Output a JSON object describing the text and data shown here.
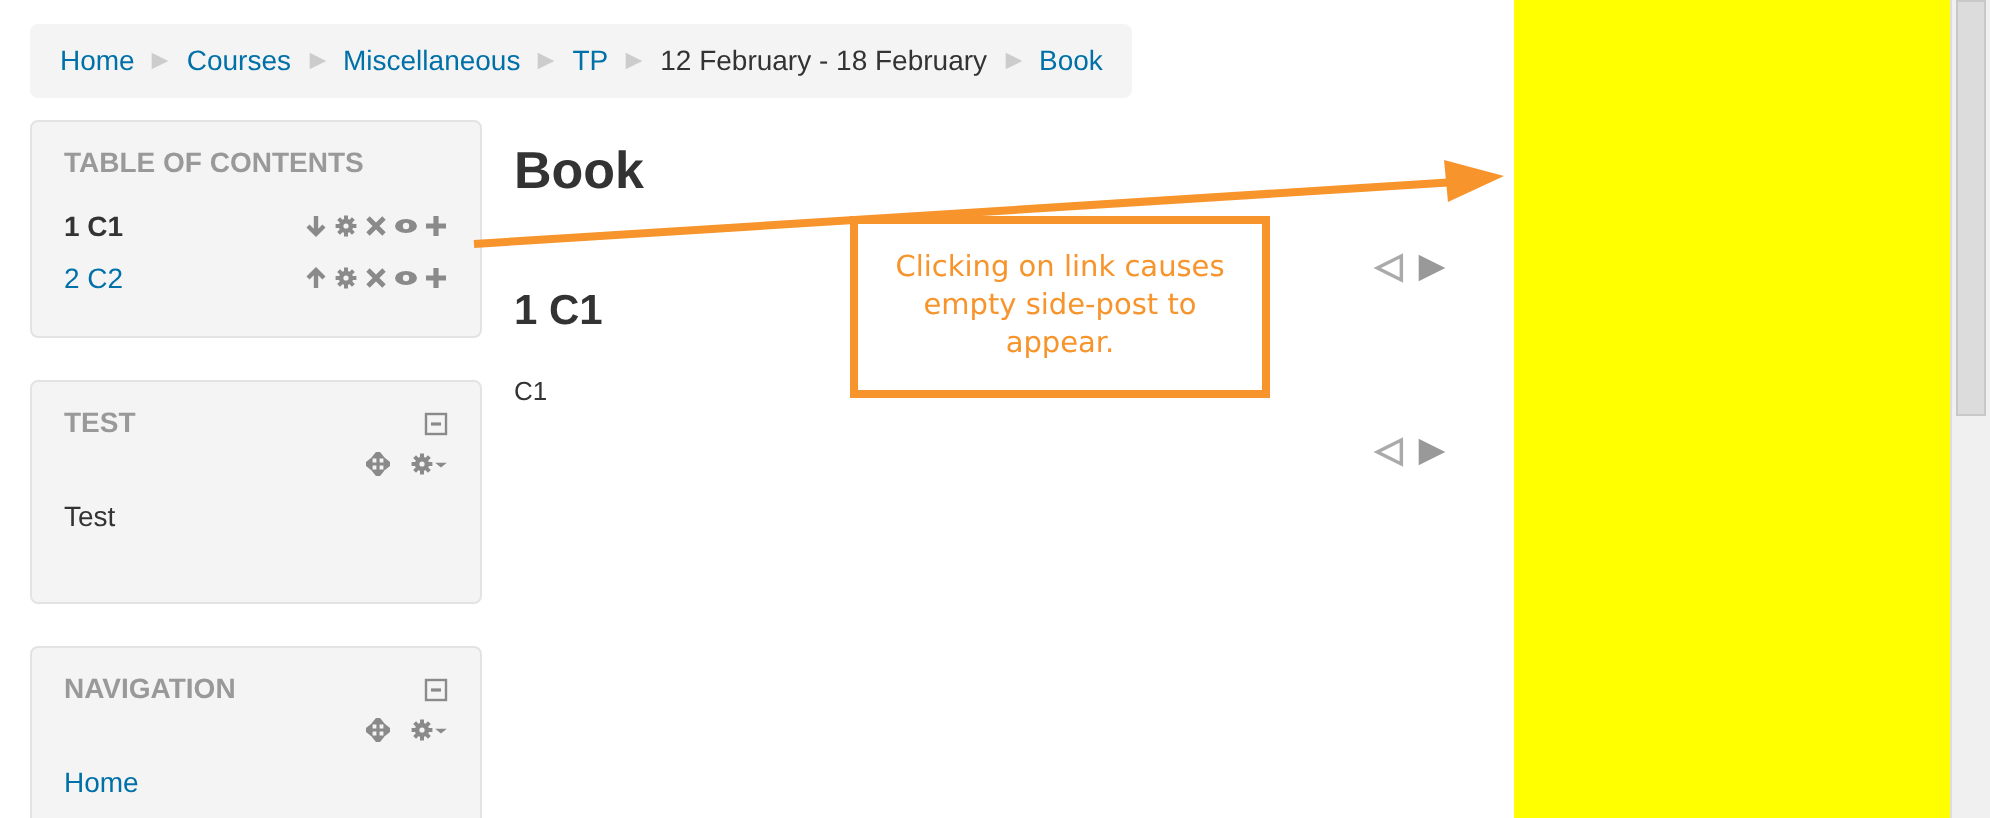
{
  "breadcrumb": [
    {
      "label": "Home",
      "kind": "link"
    },
    {
      "label": "Courses",
      "kind": "link"
    },
    {
      "label": "Miscellaneous",
      "kind": "link"
    },
    {
      "label": "TP",
      "kind": "link"
    },
    {
      "label": "12 February - 18 February",
      "kind": "text"
    },
    {
      "label": "Book",
      "kind": "link"
    }
  ],
  "toc": {
    "title": "TABLE OF CONTENTS",
    "items": [
      {
        "label": "1 C1",
        "selected": true,
        "kind": "down"
      },
      {
        "label": "2 C2",
        "selected": false,
        "kind": "up"
      }
    ]
  },
  "blocks": [
    {
      "title": "TEST",
      "kind": "text",
      "content": "Test"
    },
    {
      "title": "NAVIGATION",
      "kind": "links",
      "links": [
        "Home"
      ]
    }
  ],
  "main": {
    "title": "Book",
    "chapter": "1 C1",
    "body": "C1"
  },
  "annotation": {
    "text": "Clicking on link causes empty side-post to appear."
  }
}
